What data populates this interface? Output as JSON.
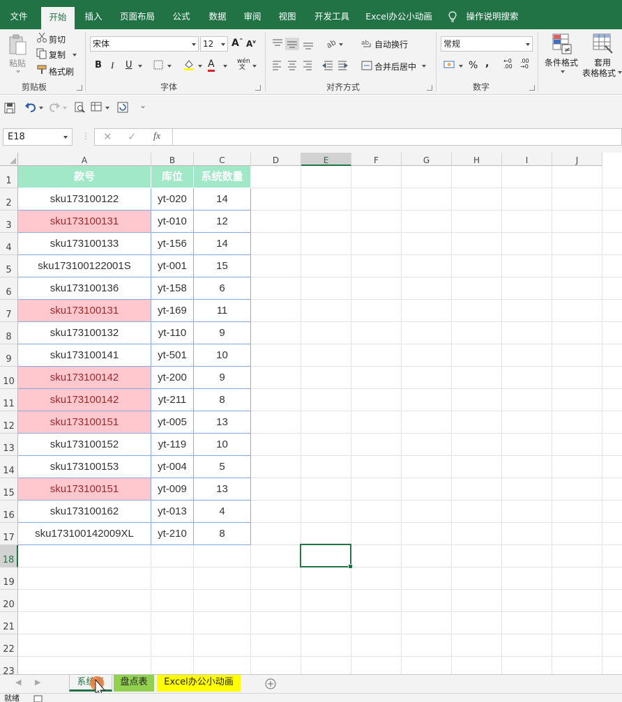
{
  "menu": {
    "tabs": [
      "文件",
      "开始",
      "插入",
      "页面布局",
      "公式",
      "数据",
      "审阅",
      "视图",
      "开发工具",
      "Excel办公小动画"
    ],
    "active_tab": "开始",
    "search": "操作说明搜索"
  },
  "ribbon": {
    "clipboard": {
      "paste": "粘贴",
      "cut": "剪切",
      "copy": "复制",
      "format_painter": "格式刷",
      "label": "剪贴板"
    },
    "font": {
      "font_name": "宋体",
      "font_size": "12",
      "bold": "B",
      "italic": "I",
      "underline": "U",
      "font_color_glyph": "A",
      "label": "字体"
    },
    "alignment": {
      "wrap_text": "自动换行",
      "merge_center": "合并后居中",
      "label": "对齐方式"
    },
    "number": {
      "format": "常规",
      "percent": "%",
      "comma": ",",
      "label": "数字"
    },
    "styles": {
      "conditional_format": "条件格式",
      "table_format_1": "套用",
      "table_format_2": "表格格式"
    }
  },
  "formula_bar": {
    "name_box": "E18",
    "fx": "fx",
    "value": ""
  },
  "columns": [
    "A",
    "B",
    "C",
    "D",
    "E",
    "F",
    "G",
    "H",
    "I",
    "J"
  ],
  "rows": [
    "1",
    "2",
    "3",
    "4",
    "5",
    "6",
    "7",
    "8",
    "9",
    "10",
    "11",
    "12",
    "13",
    "14",
    "15",
    "16",
    "17",
    "18",
    "19",
    "20",
    "21",
    "22",
    "23"
  ],
  "selected_cell": {
    "col": "E",
    "row": "18"
  },
  "table": {
    "headers": [
      "款号",
      "库位",
      "系统数量"
    ],
    "rows": [
      {
        "sku": "sku173100122",
        "loc": "yt-020",
        "qty": "14",
        "dup": false
      },
      {
        "sku": "sku173100131",
        "loc": "yt-010",
        "qty": "12",
        "dup": true
      },
      {
        "sku": "sku173100133",
        "loc": "yt-156",
        "qty": "14",
        "dup": false
      },
      {
        "sku": "sku173100122001S",
        "loc": "yt-001",
        "qty": "15",
        "dup": false
      },
      {
        "sku": "sku173100136",
        "loc": "yt-158",
        "qty": "6",
        "dup": false
      },
      {
        "sku": "sku173100131",
        "loc": "yt-169",
        "qty": "11",
        "dup": true
      },
      {
        "sku": "sku173100132",
        "loc": "yt-110",
        "qty": "9",
        "dup": false
      },
      {
        "sku": "sku173100141",
        "loc": "yt-501",
        "qty": "10",
        "dup": false
      },
      {
        "sku": "sku173100142",
        "loc": "yt-200",
        "qty": "9",
        "dup": true
      },
      {
        "sku": "sku173100142",
        "loc": "yt-211",
        "qty": "8",
        "dup": true
      },
      {
        "sku": "sku173100151",
        "loc": "yt-005",
        "qty": "13",
        "dup": true
      },
      {
        "sku": "sku173100152",
        "loc": "yt-119",
        "qty": "10",
        "dup": false
      },
      {
        "sku": "sku173100153",
        "loc": "yt-004",
        "qty": "5",
        "dup": false
      },
      {
        "sku": "sku173100151",
        "loc": "yt-009",
        "qty": "13",
        "dup": true
      },
      {
        "sku": "sku173100162",
        "loc": "yt-013",
        "qty": "4",
        "dup": false
      },
      {
        "sku": "sku173100142009XL",
        "loc": "yt-210",
        "qty": "8",
        "dup": false
      }
    ]
  },
  "sheets": [
    {
      "name": "系统表",
      "color": "#f3f3f3",
      "active": true
    },
    {
      "name": "盘点表",
      "color": "#92d050",
      "active": false
    },
    {
      "name": "Excel办公小动画",
      "color": "#ffff00",
      "active": false
    }
  ],
  "status": {
    "ready": "就绪"
  },
  "colors": {
    "accent": "#217346",
    "header_fill": "#a0e8c8",
    "dup_fill": "#ffc7ce",
    "dup_text": "#9c2a2a",
    "table_border": "#8ea9db"
  }
}
